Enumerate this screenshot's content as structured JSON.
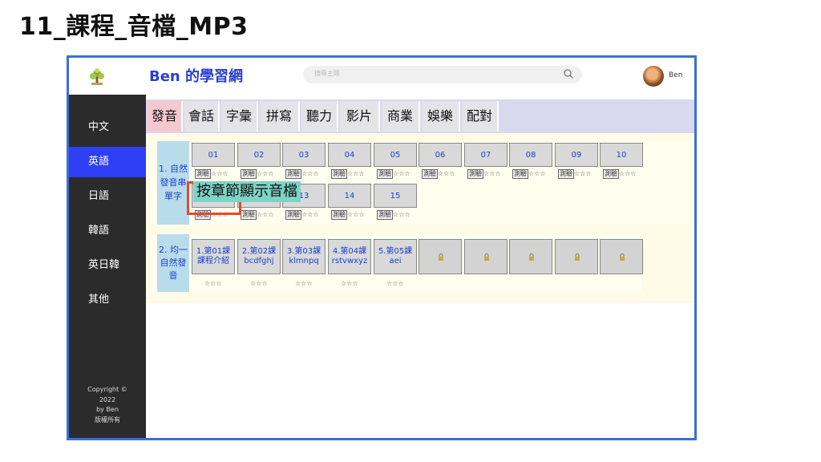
{
  "slide_title": "11_課程_音檔_MP3",
  "header": {
    "site_title": "Ben 的學習網",
    "search_placeholder": "搜尋主題",
    "user_name": "Ben"
  },
  "sidebar": {
    "items": [
      {
        "label": "中文",
        "active": false
      },
      {
        "label": "英語",
        "active": true
      },
      {
        "label": "日語",
        "active": false
      },
      {
        "label": "韓語",
        "active": false
      },
      {
        "label": "英日韓",
        "active": false
      },
      {
        "label": "其他",
        "active": false
      }
    ],
    "copyright": [
      "Copyright ©",
      "2022",
      "by Ben",
      "版權所有"
    ]
  },
  "tabs": [
    {
      "label": "發音",
      "active": true
    },
    {
      "label": "會話",
      "active": false
    },
    {
      "label": "字彙",
      "active": false
    },
    {
      "label": "拼寫",
      "active": false
    },
    {
      "label": "聽力",
      "active": false
    },
    {
      "label": "影片",
      "active": false
    },
    {
      "label": "商業",
      "active": false
    },
    {
      "label": "娛樂",
      "active": false
    },
    {
      "label": "配對",
      "active": false
    }
  ],
  "section1": {
    "label_lines": [
      "1. 自然",
      "發音串",
      "單字"
    ],
    "row1": [
      "01",
      "02",
      "03",
      "04",
      "05",
      "06",
      "07",
      "08",
      "09",
      "10"
    ],
    "row2": [
      "11",
      "12",
      "13",
      "14",
      "15"
    ],
    "quiz_label": "測驗",
    "stars": "☆☆☆"
  },
  "section2": {
    "label_lines": [
      "2. 均一",
      "自然發",
      "音"
    ],
    "lessons": [
      {
        "line1": "1.第01課",
        "line2": "課程介紹"
      },
      {
        "line1": "2.第02課",
        "line2": "bcdfghj"
      },
      {
        "line1": "3.第03課",
        "line2": "klmnpq"
      },
      {
        "line1": "4.第04課",
        "line2": "rstvwxyz"
      },
      {
        "line1": "5.第05課",
        "line2": "aei"
      }
    ],
    "locked_count": 5,
    "stars": "☆☆☆"
  },
  "annotation": {
    "text": "按章節顯示音檔"
  },
  "colors": {
    "accent_blue": "#2e3ff5",
    "frame_border": "#3a6fd8",
    "callout_red": "#e6492d",
    "label_bg": "#b9dcea",
    "overlay_bg": "#7dd3c6"
  }
}
